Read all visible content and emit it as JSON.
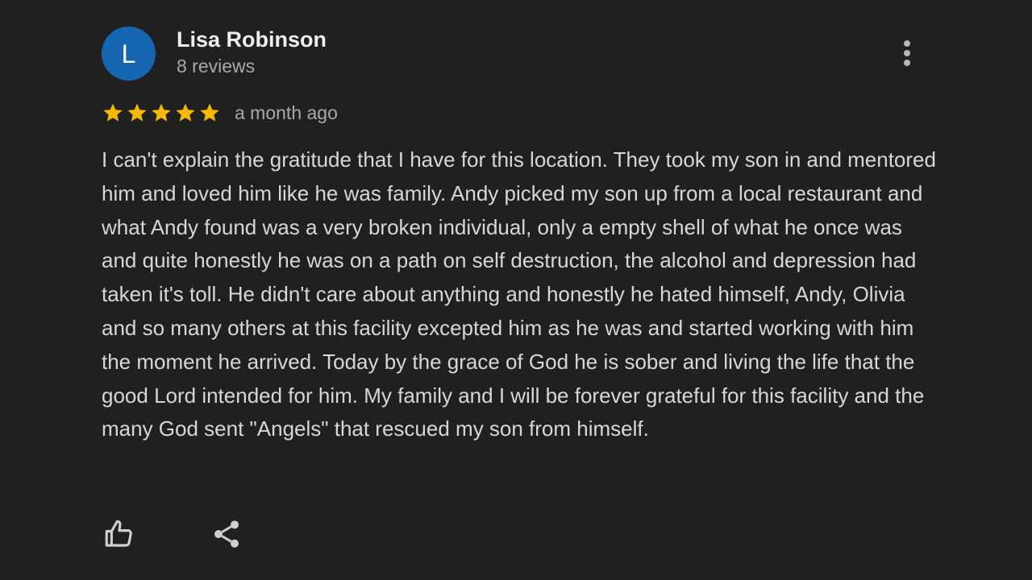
{
  "reviewer": {
    "initial": "L",
    "name": "Lisa Robinson",
    "review_count": "8 reviews",
    "avatar_color": "#1565b0"
  },
  "rating": {
    "stars": 5,
    "max": 5,
    "star_color": "#f6b800",
    "time_ago": "a month ago"
  },
  "review_text": "I can't explain the gratitude that I have for this location. They took my son in and mentored him and loved him like he was family. Andy picked my son up from a local restaurant and what Andy found was a very broken individual, only a empty shell of what he once was and quite honestly he was on a path on self destruction, the alcohol and depression had taken it's toll. He didn't care about anything and honestly he hated himself, Andy, Olivia and so many others at this facility excepted him as he was and started working with him the moment he arrived. Today by the grace of God he is sober and living the life that the good Lord intended for him. My family and I will be forever grateful for this facility and the many God sent \"Angels\" that rescued my son from himself.",
  "menu": {
    "icon": "more-vert-icon"
  },
  "actions": {
    "like_icon": "thumbs-up-icon",
    "share_icon": "share-icon"
  }
}
